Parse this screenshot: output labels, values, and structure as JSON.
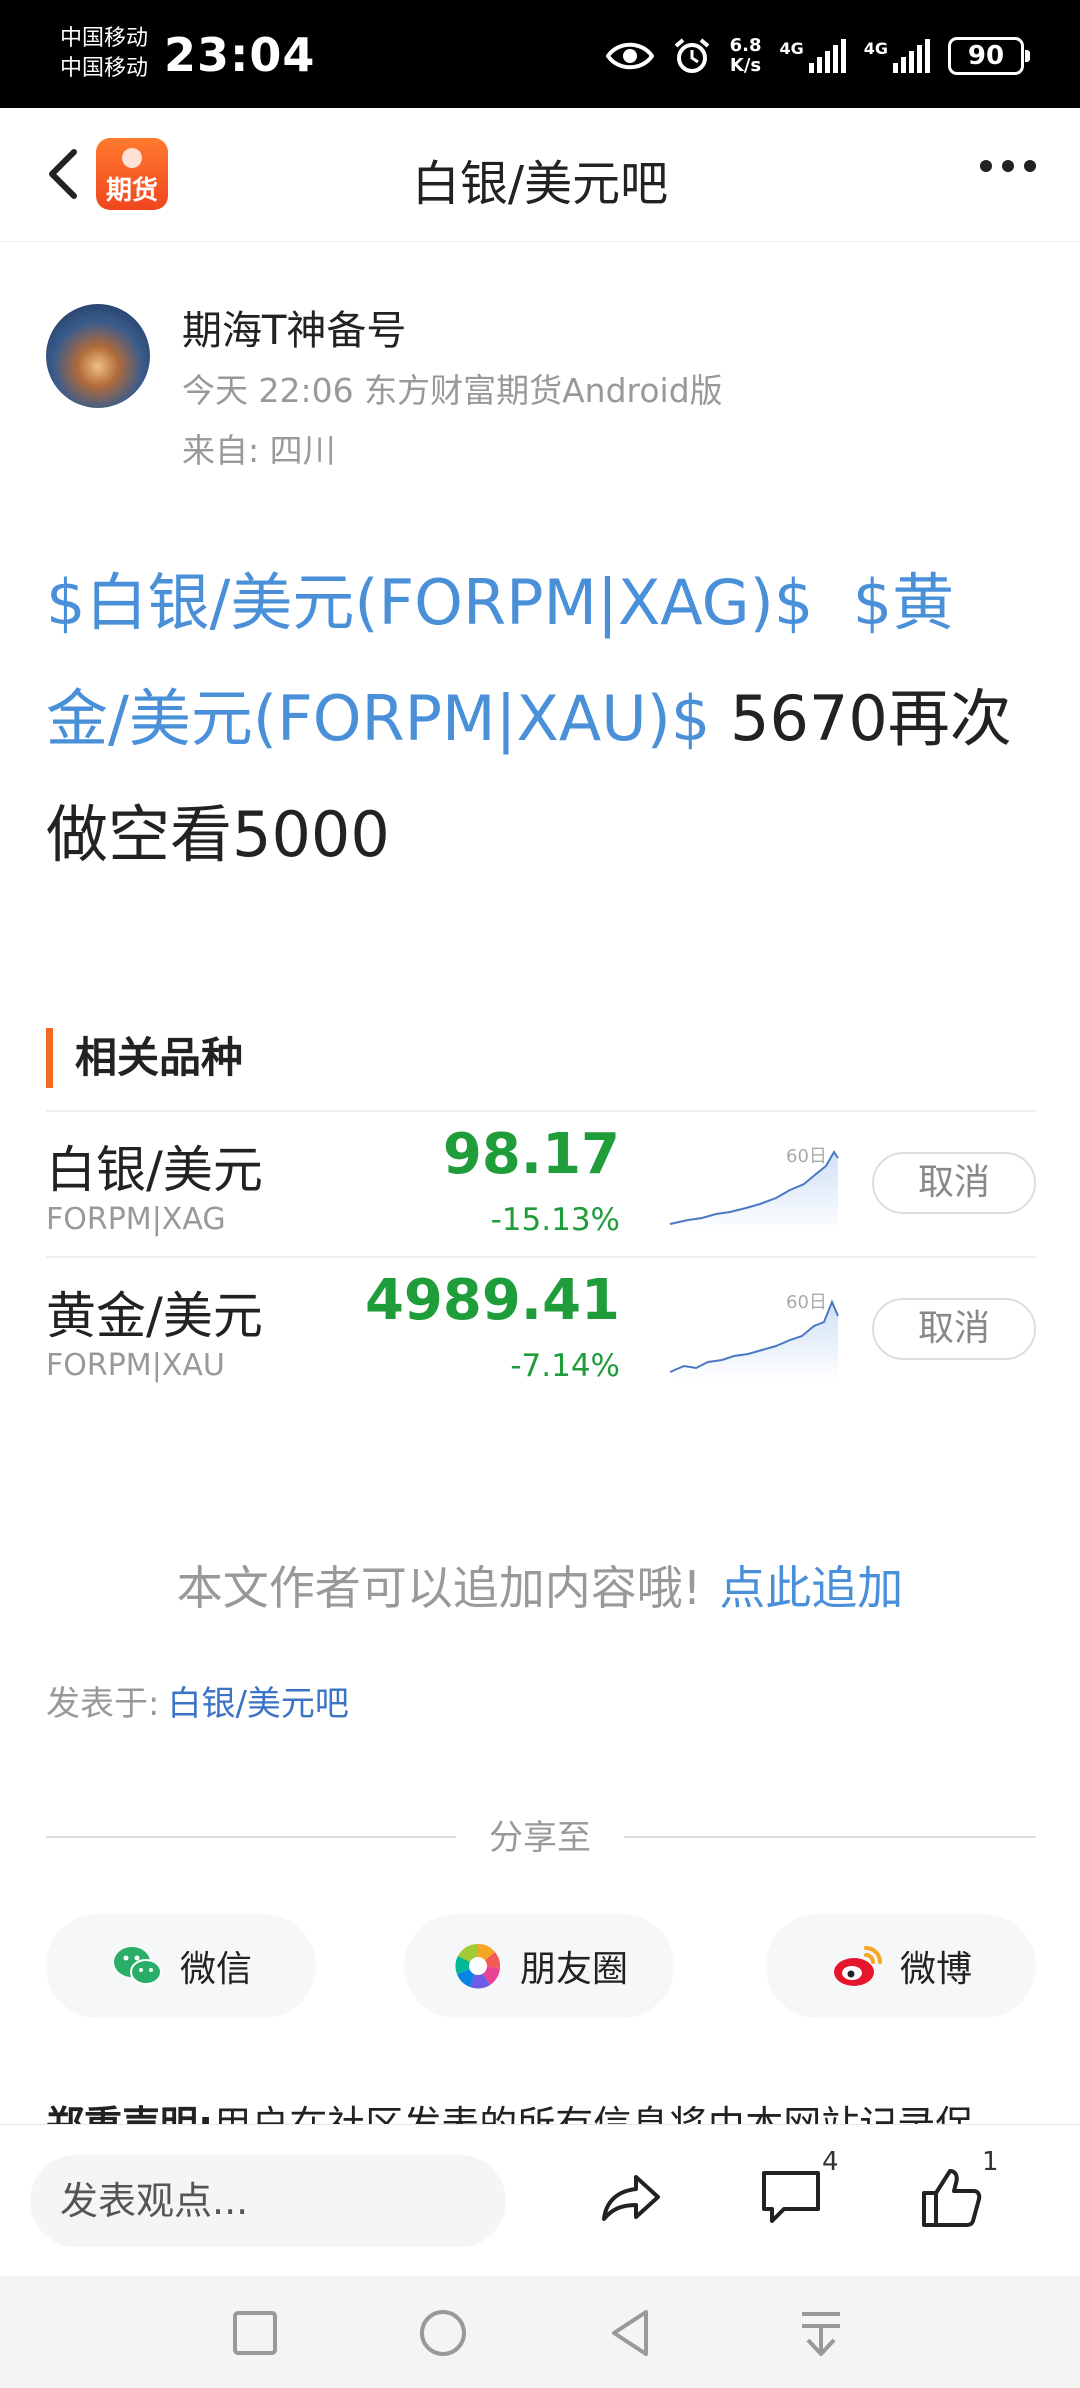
{
  "status_bar": {
    "carrier1": "中国移动",
    "carrier2": "中国移动",
    "time": "23:04",
    "net_speed_value": "6.8",
    "net_speed_unit": "K/s",
    "sig1_label": "4G",
    "sig2_label": "4G",
    "battery": "90"
  },
  "header": {
    "title": "白银/美元吧",
    "app_icon_label": "期货"
  },
  "post": {
    "author": "期海T神备号",
    "meta": "今天 22:06 东方财富期货Android版",
    "location": "来自: 四川",
    "link1": "$白银/美元(FORPM|XAG)$",
    "link2": "$黄金/美元(FORPM|XAU)$",
    "text": " 5670再次做空看5000"
  },
  "related": {
    "title": "相关品种",
    "items": [
      {
        "name": "白银/美元",
        "code": "FORPM|XAG",
        "price": "98.17",
        "change": "-15.13%",
        "spark_label": "60日",
        "action": "取消"
      },
      {
        "name": "黄金/美元",
        "code": "FORPM|XAU",
        "price": "4989.41",
        "change": "-7.14%",
        "spark_label": "60日",
        "action": "取消"
      }
    ]
  },
  "append": {
    "text": "本文作者可以追加内容哦!",
    "link": "点此追加"
  },
  "posted_in": {
    "label": "发表于:",
    "link": "白银/美元吧"
  },
  "share": {
    "label": "分享至",
    "buttons": [
      {
        "label": "微信",
        "icon": "wechat-icon"
      },
      {
        "label": "朋友圈",
        "icon": "moments-icon"
      },
      {
        "label": "微博",
        "icon": "weibo-icon"
      }
    ]
  },
  "disclaimer": {
    "title": "郑重声明:",
    "text": "用户在社区发表的所有信息将由本网站记录保"
  },
  "bottom_bar": {
    "comment_placeholder": "发表观点...",
    "comment_count": "4",
    "like_count": "1"
  },
  "colors": {
    "link": "#4a90d9",
    "down_green": "#1f9d3a",
    "accent_orange": "#f26a21"
  }
}
